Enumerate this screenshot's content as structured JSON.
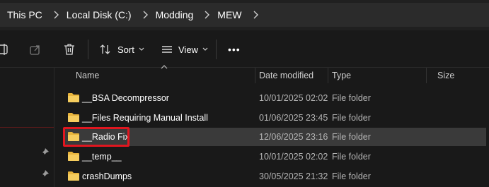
{
  "breadcrumb": [
    "This PC",
    "Local Disk (C:)",
    "Modding",
    "MEW"
  ],
  "toolbar": {
    "sort_label": "Sort",
    "view_label": "View",
    "more_label": "•••"
  },
  "columns": {
    "name": "Name",
    "date_modified": "Date modified",
    "type": "Type",
    "size": "Size"
  },
  "files": [
    {
      "name": "__BSA Decompressor",
      "date": "10/01/2025 02:02",
      "type": "File folder"
    },
    {
      "name": "__Files Requiring Manual Install",
      "date": "01/06/2025 23:45",
      "type": "File folder"
    },
    {
      "name": "__Radio Fix",
      "date": "12/06/2025 23:16",
      "type": "File folder",
      "selected": true
    },
    {
      "name": "__temp__",
      "date": "10/01/2025 02:02",
      "type": "File folder"
    },
    {
      "name": "crashDumps",
      "date": "30/05/2025 21:32",
      "type": "File folder"
    }
  ],
  "colors": {
    "highlight": "#e0161f",
    "folder": "#f2c14e",
    "selected_row": "#3a3a3a"
  }
}
